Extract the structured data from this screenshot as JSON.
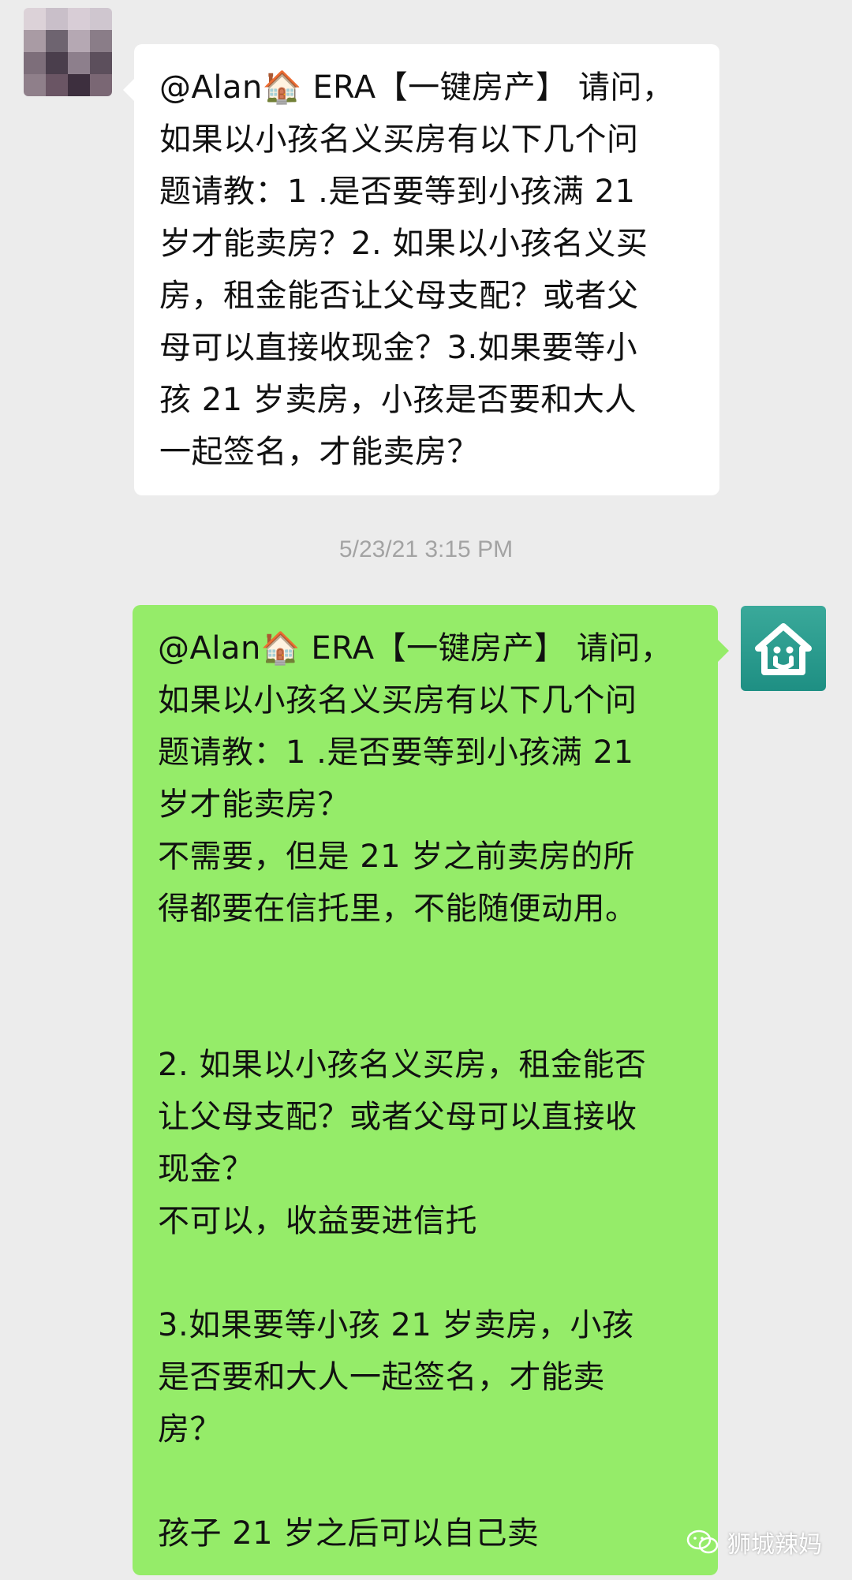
{
  "received_message": {
    "lines": [
      "@Alan🏠 ERA【一键房产】 请问，",
      "如果以小孩名义买房有以下几个问",
      "题请教：1 .是否要等到小孩满 21",
      "岁才能卖房？2. 如果以小孩名义买",
      "房，租金能否让父母支配？或者父",
      "母可以直接收现金？3.如果要等小",
      "孩 21 岁卖房，小孩是否要和大人",
      "一起签名，才能卖房？"
    ]
  },
  "timestamp": "5/23/21 3:15 PM",
  "sent_message": {
    "lines": [
      "@Alan🏠 ERA【一键房产】 请问，",
      "如果以小孩名义买房有以下几个问",
      "题请教：1 .是否要等到小孩满 21",
      "岁才能卖房？",
      "不需要，但是 21 岁之前卖房的所",
      "得都要在信托里，不能随便动用。",
      "",
      "",
      "2. 如果以小孩名义买房，租金能否",
      "让父母支配？或者父母可以直接收",
      "现金？",
      "不可以，收益要进信托",
      "",
      "3.如果要等小孩 21 岁卖房，小孩",
      "是否要和大人一起签名，才能卖",
      "房？",
      "",
      "孩子 21 岁之后可以自己卖"
    ]
  },
  "watermark": {
    "icon": "wechat-icon",
    "text": "狮城辣妈"
  },
  "colors": {
    "background": "#ececec",
    "received_bubble": "#ffffff",
    "sent_bubble": "#95ec69",
    "avatar_teal": "#2a9d8f",
    "timestamp_text": "#a3a3a3"
  },
  "avatars": {
    "left": "blurred-avatar",
    "right": "house-logo-icon"
  }
}
